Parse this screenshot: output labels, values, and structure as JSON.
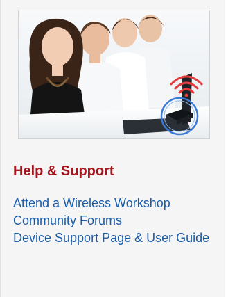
{
  "colors": {
    "heading": "#a8141e",
    "link": "#1a5dab"
  },
  "photo": {
    "description_icons": [
      "wifi-icon",
      "router-icon"
    ]
  },
  "help_support": {
    "heading": "Help & Support",
    "links": [
      {
        "label": "Attend a Wireless Workshop"
      },
      {
        "label": "Community Forums"
      },
      {
        "label": "Device Support Page & User Guide"
      }
    ]
  }
}
